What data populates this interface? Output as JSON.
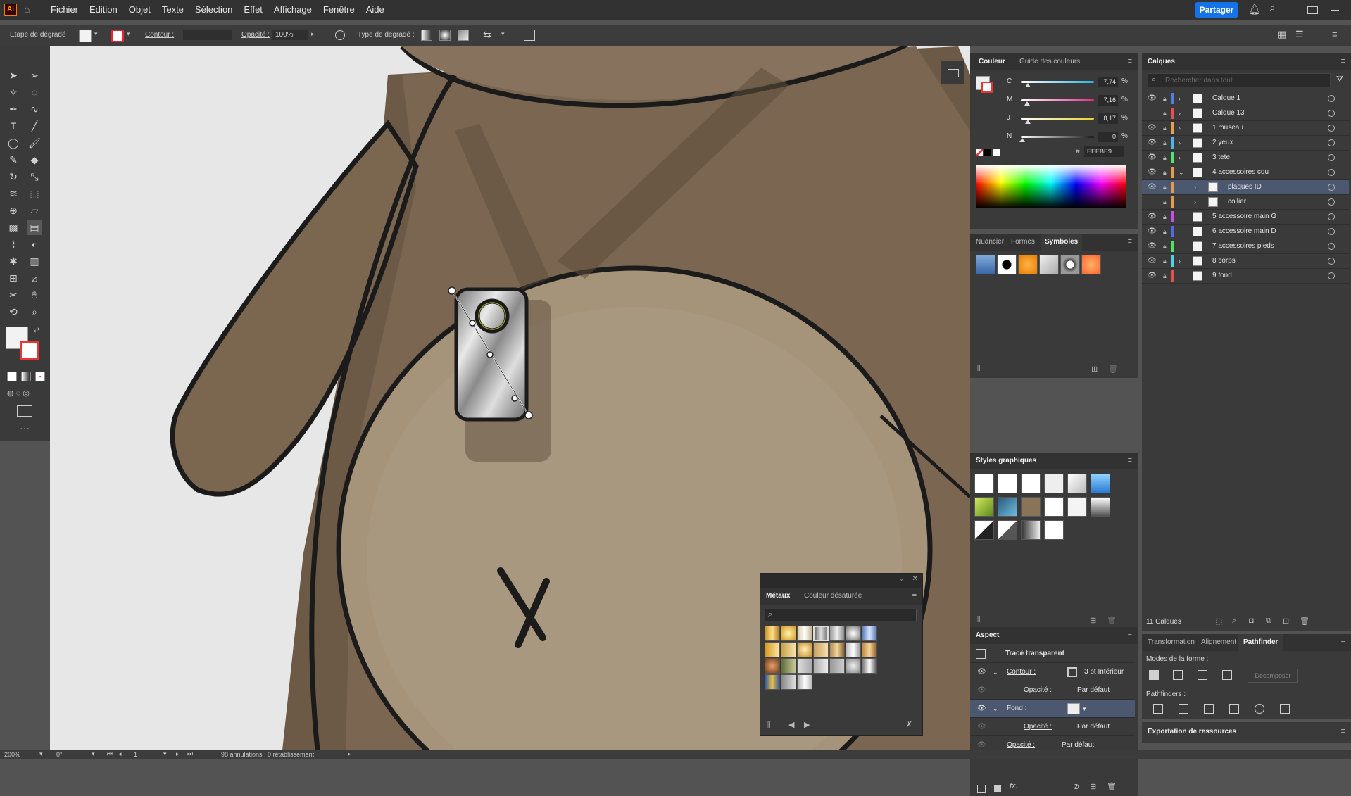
{
  "menubar": {
    "app_logo": "Ai",
    "items": [
      "Fichier",
      "Edition",
      "Objet",
      "Texte",
      "Sélection",
      "Effet",
      "Affichage",
      "Fenêtre",
      "Aide"
    ],
    "share_label": "Partager"
  },
  "control": {
    "tool_label": "Etape de dégradé",
    "contour_label": "Contour :",
    "opacity_label": "Opacité :",
    "opacity_value": "100%",
    "gradient_type_label": "Type de dégradé :"
  },
  "color_panel": {
    "tabs": [
      "Couleur",
      "Guide des couleurs"
    ],
    "channels": [
      {
        "label": "C",
        "value": "7,74",
        "pct": "%",
        "fill": 0.08,
        "color": "#28b4e6"
      },
      {
        "label": "M",
        "value": "7,16",
        "pct": "%",
        "fill": 0.07,
        "color": "#e6288c"
      },
      {
        "label": "J",
        "value": "8,17",
        "pct": "%",
        "fill": 0.08,
        "color": "#e6d228"
      },
      {
        "label": "N",
        "value": "0",
        "pct": "%",
        "fill": 0.0,
        "color": "#1a1a1a"
      }
    ],
    "hash": "#",
    "hex": "EEEBE9"
  },
  "symbols_panel": {
    "tabs": [
      "Nuancier",
      "Formes",
      "Symboles"
    ]
  },
  "styles_panel": {
    "title": "Styles graphiques"
  },
  "metals_panel": {
    "tabs": [
      "Métaux",
      "Couleur désaturée"
    ]
  },
  "aspect_panel": {
    "title": "Aspect",
    "object": "Tracé transparent",
    "contour_label": "Contour :",
    "contour_value": "3 pt  Intérieur",
    "opacity_label": "Opacité :",
    "opacity_value": "Par défaut",
    "fill_label": "Fond :",
    "opacity2_label": "Opacité :",
    "opacity2_value": "Par défaut",
    "opacity3_label": "Opacité :",
    "opacity3_value": "Par défaut"
  },
  "layers_panel": {
    "title": "Calques",
    "search_placeholder": "Rechercher dans tout",
    "count": "11 Calques",
    "layers": [
      {
        "name": "Calque 1",
        "color": "#4f7fe6",
        "indent": 0,
        "eye": true,
        "chevron": true,
        "selected": false
      },
      {
        "name": "Calque 13",
        "color": "#e64f4f",
        "indent": 0,
        "eye": false,
        "chevron": true,
        "selected": false
      },
      {
        "name": "1 museau",
        "color": "#e6a04f",
        "indent": 0,
        "eye": true,
        "chevron": true,
        "selected": false
      },
      {
        "name": "2 yeux",
        "color": "#4fb4e6",
        "indent": 0,
        "eye": true,
        "chevron": true,
        "selected": false
      },
      {
        "name": "3 tete",
        "color": "#4fe66e",
        "indent": 0,
        "eye": true,
        "chevron": true,
        "selected": false
      },
      {
        "name": "4 accessoires cou",
        "color": "#e6994f",
        "indent": 0,
        "eye": true,
        "chevron": true,
        "selected": false
      },
      {
        "name": "plaques ID",
        "color": "#e6994f",
        "indent": 1,
        "eye": true,
        "chevron": true,
        "selected": true
      },
      {
        "name": "collier",
        "color": "#e6994f",
        "indent": 1,
        "eye": false,
        "chevron": true,
        "selected": false
      },
      {
        "name": "5 accessoire main G",
        "color": "#c84fe6",
        "indent": 0,
        "eye": true,
        "chevron": false,
        "selected": false
      },
      {
        "name": "6 accessoire main D",
        "color": "#4f6be6",
        "indent": 0,
        "eye": true,
        "chevron": false,
        "selected": false
      },
      {
        "name": "7 accessoires pieds",
        "color": "#4fe65e",
        "indent": 0,
        "eye": true,
        "chevron": false,
        "selected": false
      },
      {
        "name": "8 corps",
        "color": "#4fd2e6",
        "indent": 0,
        "eye": true,
        "chevron": true,
        "selected": false
      },
      {
        "name": "9 fond",
        "color": "#e64f4f",
        "indent": 0,
        "eye": true,
        "chevron": false,
        "selected": false
      }
    ]
  },
  "bottom_tabs": [
    "Transformation",
    "Alignement",
    "Pathfinder"
  ],
  "pathfinder": {
    "modes_label": "Modes de la forme :",
    "decompose_label": "Décomposer",
    "pathfinders_label": "Pathfinders :"
  },
  "export_label": "Exportation de ressources",
  "status": {
    "zoom": "200%",
    "rotation": "0°",
    "artboard": "1",
    "history": "98 annulations ; 0 rétablissement"
  }
}
